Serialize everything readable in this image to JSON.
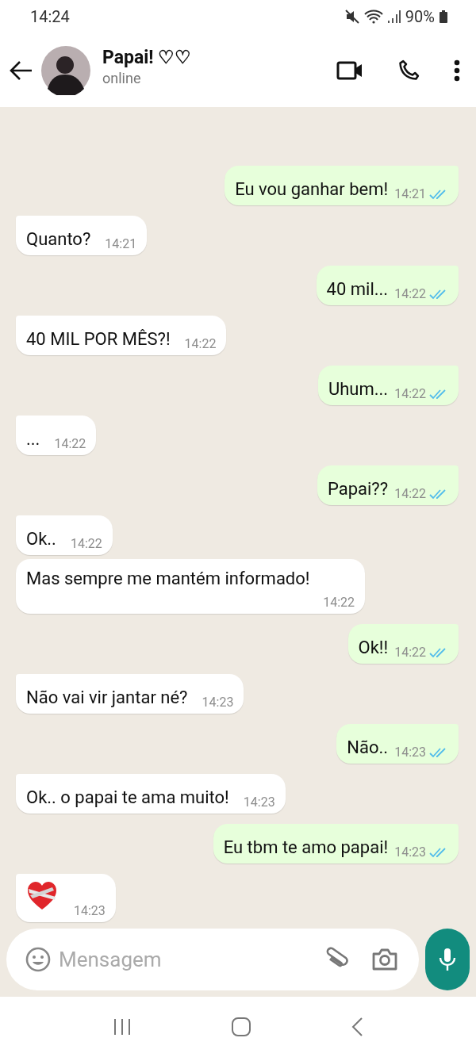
{
  "status_bar": {
    "time": "14:24",
    "battery": "90%"
  },
  "header": {
    "name": "Papai! ♡♡",
    "status": "online"
  },
  "messages": [
    {
      "kind": "text",
      "outgoing": true,
      "text": "Eu vou ganhar bem!",
      "time": "14:21",
      "read": true
    },
    {
      "kind": "text",
      "outgoing": false,
      "text": "Quanto?",
      "time": "14:21"
    },
    {
      "kind": "text",
      "outgoing": true,
      "text": "40 mil...",
      "time": "14:22",
      "read": true
    },
    {
      "kind": "text",
      "outgoing": false,
      "text": "40 MIL POR MÊS?!",
      "time": "14:22"
    },
    {
      "kind": "text",
      "outgoing": true,
      "text": "Uhum...",
      "time": "14:22",
      "read": true
    },
    {
      "kind": "text",
      "outgoing": false,
      "text": "...",
      "time": "14:22"
    },
    {
      "kind": "text",
      "outgoing": true,
      "text": "Papai??",
      "time": "14:22",
      "read": true
    },
    {
      "kind": "text",
      "outgoing": false,
      "text": "Ok..",
      "time": "14:22"
    },
    {
      "kind": "text",
      "outgoing": false,
      "text": "Mas sempre me mantém informado!",
      "time": "14:22"
    },
    {
      "kind": "text",
      "outgoing": true,
      "text": "Ok!!",
      "time": "14:22",
      "read": true
    },
    {
      "kind": "text",
      "outgoing": false,
      "text": "Não vai vir jantar né?",
      "time": "14:23"
    },
    {
      "kind": "text",
      "outgoing": true,
      "text": "Não..",
      "time": "14:23",
      "read": true
    },
    {
      "kind": "text",
      "outgoing": false,
      "text": "Ok.. o papai te ama muito!",
      "time": "14:23"
    },
    {
      "kind": "text",
      "outgoing": true,
      "text": "Eu tbm te amo papai!",
      "time": "14:23",
      "read": true
    },
    {
      "kind": "emoji",
      "outgoing": false,
      "time": "14:23"
    }
  ],
  "composer": {
    "placeholder": "Mensagem"
  }
}
